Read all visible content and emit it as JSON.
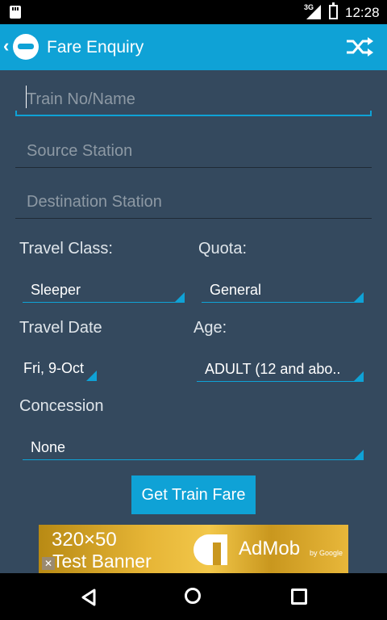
{
  "status_bar": {
    "network": "3G",
    "time": "12:28"
  },
  "app_bar": {
    "back_glyph": "‹",
    "title": "Fare Enquiry",
    "action_icon": "shuffle-icon"
  },
  "form": {
    "train": {
      "placeholder": "Train No/Name",
      "value": ""
    },
    "source": {
      "placeholder": "Source Station",
      "value": ""
    },
    "destination": {
      "placeholder": "Destination Station",
      "value": ""
    },
    "travel_class": {
      "label": "Travel Class:",
      "value": "Sleeper"
    },
    "quota": {
      "label": "Quota:",
      "value": "General"
    },
    "travel_date": {
      "label": "Travel Date",
      "value": "Fri, 9-Oct"
    },
    "age": {
      "label": "Age:",
      "value": "ADULT (12 and abo.."
    },
    "concession": {
      "label": "Concession",
      "value": "None"
    },
    "submit_label": "Get Train Fare"
  },
  "ad_banner": {
    "line1": "320×50",
    "line2": "Test Banner",
    "close": "✕",
    "brand": "AdMob",
    "by": "by Google"
  },
  "colors": {
    "accent": "#0fa2d6",
    "background": "#34495e",
    "statusbar": "#000000"
  },
  "nav": {
    "back_icon": "back-triangle-icon",
    "home_icon": "home-circle-icon",
    "recent_icon": "recent-square-icon"
  }
}
